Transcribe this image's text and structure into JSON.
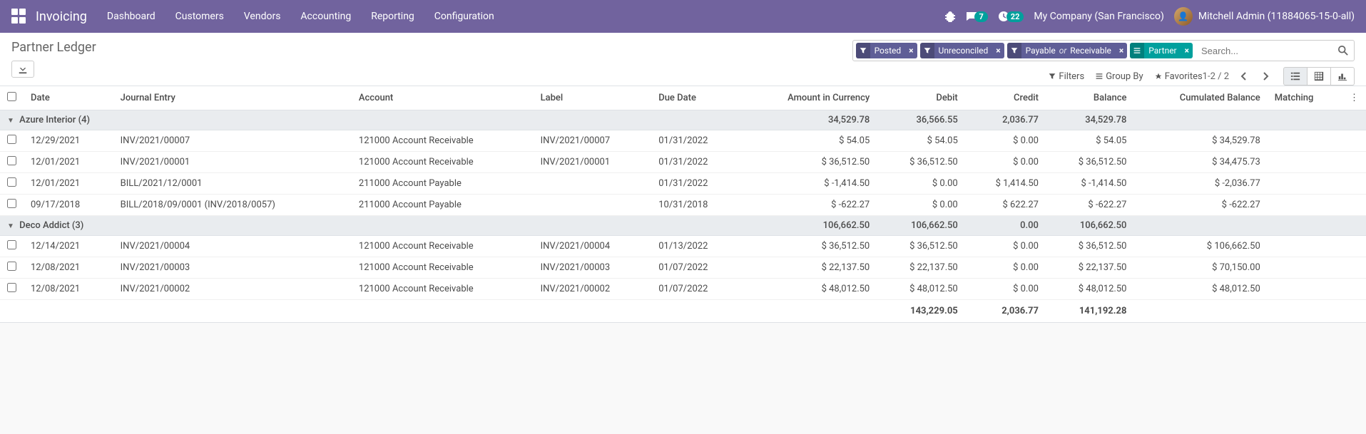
{
  "nav": {
    "brand": "Invoicing",
    "menu": [
      "Dashboard",
      "Customers",
      "Vendors",
      "Accounting",
      "Reporting",
      "Configuration"
    ],
    "messages_badge": "7",
    "activities_badge": "22",
    "company": "My Company (San Francisco)",
    "user": "Mitchell Admin (11884065-15-0-all)"
  },
  "cp": {
    "title": "Partner Ledger",
    "facets": [
      {
        "type": "filter",
        "label": "Posted"
      },
      {
        "type": "filter",
        "label": "Unreconciled"
      },
      {
        "type": "filter",
        "label_html": "Payable <em>or</em> Receivable"
      },
      {
        "type": "group",
        "label": "Partner"
      }
    ],
    "search_placeholder": "Search...",
    "filters_label": "Filters",
    "groupby_label": "Group By",
    "favorites_label": "Favorites",
    "pager": "1-2 / 2"
  },
  "columns": {
    "date": "Date",
    "journal_entry": "Journal Entry",
    "account": "Account",
    "label": "Label",
    "due_date": "Due Date",
    "amount_currency": "Amount in Currency",
    "debit": "Debit",
    "credit": "Credit",
    "balance": "Balance",
    "cumulated": "Cumulated Balance",
    "matching": "Matching"
  },
  "groups": [
    {
      "header": {
        "title": "Azure Interior (4)",
        "amount_currency": "34,529.78",
        "debit": "36,566.55",
        "credit": "2,036.77",
        "balance": "34,529.78"
      },
      "rows": [
        {
          "date": "12/29/2021",
          "journal_entry": "INV/2021/00007",
          "account": "121000 Account Receivable",
          "label": "INV/2021/00007",
          "due_date": "01/31/2022",
          "amount_currency": "$ 54.05",
          "debit": "$ 54.05",
          "credit": "$ 0.00",
          "balance": "$ 54.05",
          "cumulated": "$ 34,529.78"
        },
        {
          "date": "12/01/2021",
          "journal_entry": "INV/2021/00001",
          "account": "121000 Account Receivable",
          "label": "INV/2021/00001",
          "due_date": "01/31/2022",
          "amount_currency": "$ 36,512.50",
          "debit": "$ 36,512.50",
          "credit": "$ 0.00",
          "balance": "$ 36,512.50",
          "cumulated": "$ 34,475.73"
        },
        {
          "date": "12/01/2021",
          "journal_entry": "BILL/2021/12/0001",
          "account": "211000 Account Payable",
          "label": "",
          "due_date": "01/31/2022",
          "amount_currency": "$ -1,414.50",
          "debit": "$ 0.00",
          "credit": "$ 1,414.50",
          "balance": "$ -1,414.50",
          "cumulated": "$ -2,036.77"
        },
        {
          "date": "09/17/2018",
          "journal_entry": "BILL/2018/09/0001 (INV/2018/0057)",
          "account": "211000 Account Payable",
          "label": "",
          "due_date": "10/31/2018",
          "amount_currency": "$ -622.27",
          "debit": "$ 0.00",
          "credit": "$ 622.27",
          "balance": "$ -622.27",
          "cumulated": "$ -622.27"
        }
      ]
    },
    {
      "header": {
        "title": "Deco Addict (3)",
        "amount_currency": "106,662.50",
        "debit": "106,662.50",
        "credit": "0.00",
        "balance": "106,662.50"
      },
      "rows": [
        {
          "date": "12/14/2021",
          "journal_entry": "INV/2021/00004",
          "account": "121000 Account Receivable",
          "label": "INV/2021/00004",
          "due_date": "01/13/2022",
          "amount_currency": "$ 36,512.50",
          "debit": "$ 36,512.50",
          "credit": "$ 0.00",
          "balance": "$ 36,512.50",
          "cumulated": "$ 106,662.50"
        },
        {
          "date": "12/08/2021",
          "journal_entry": "INV/2021/00003",
          "account": "121000 Account Receivable",
          "label": "INV/2021/00003",
          "due_date": "01/07/2022",
          "amount_currency": "$ 22,137.50",
          "debit": "$ 22,137.50",
          "credit": "$ 0.00",
          "balance": "$ 22,137.50",
          "cumulated": "$ 70,150.00"
        },
        {
          "date": "12/08/2021",
          "journal_entry": "INV/2021/00002",
          "account": "121000 Account Receivable",
          "label": "INV/2021/00002",
          "due_date": "01/07/2022",
          "amount_currency": "$ 48,012.50",
          "debit": "$ 48,012.50",
          "credit": "$ 0.00",
          "balance": "$ 48,012.50",
          "cumulated": "$ 48,012.50"
        }
      ]
    }
  ],
  "footer": {
    "debit": "143,229.05",
    "credit": "2,036.77",
    "balance": "141,192.28"
  }
}
